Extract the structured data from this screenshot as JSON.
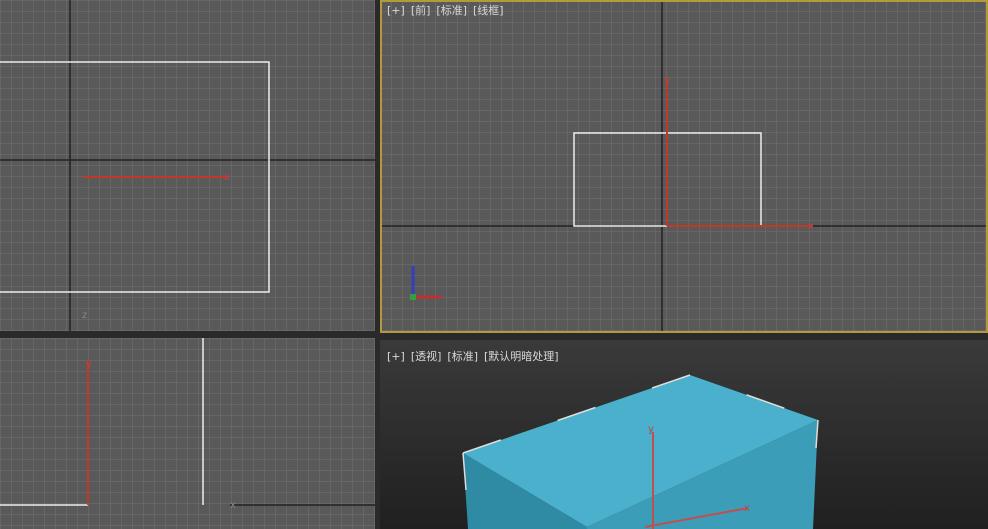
{
  "viewports": {
    "top": {
      "axis_x": "x",
      "axis_z": "z"
    },
    "front": {
      "labels": [
        "[+]",
        "[前]",
        "[标准]",
        "[线框]"
      ],
      "axis_x": "x",
      "axis_y": "y",
      "active": true
    },
    "left": {
      "axis_y": "y",
      "axis_x": "x"
    },
    "perspective": {
      "labels": [
        "[+]",
        "[透视]",
        "[标准]",
        "[默认明暗处理]"
      ],
      "axis_x": "x",
      "axis_y": "y"
    }
  },
  "colors": {
    "grid_bg": "#595959",
    "grid_line": "#6f6f6f",
    "active_border": "#b49a3c",
    "axis": "#c0392b",
    "box": "#4aafcb"
  }
}
